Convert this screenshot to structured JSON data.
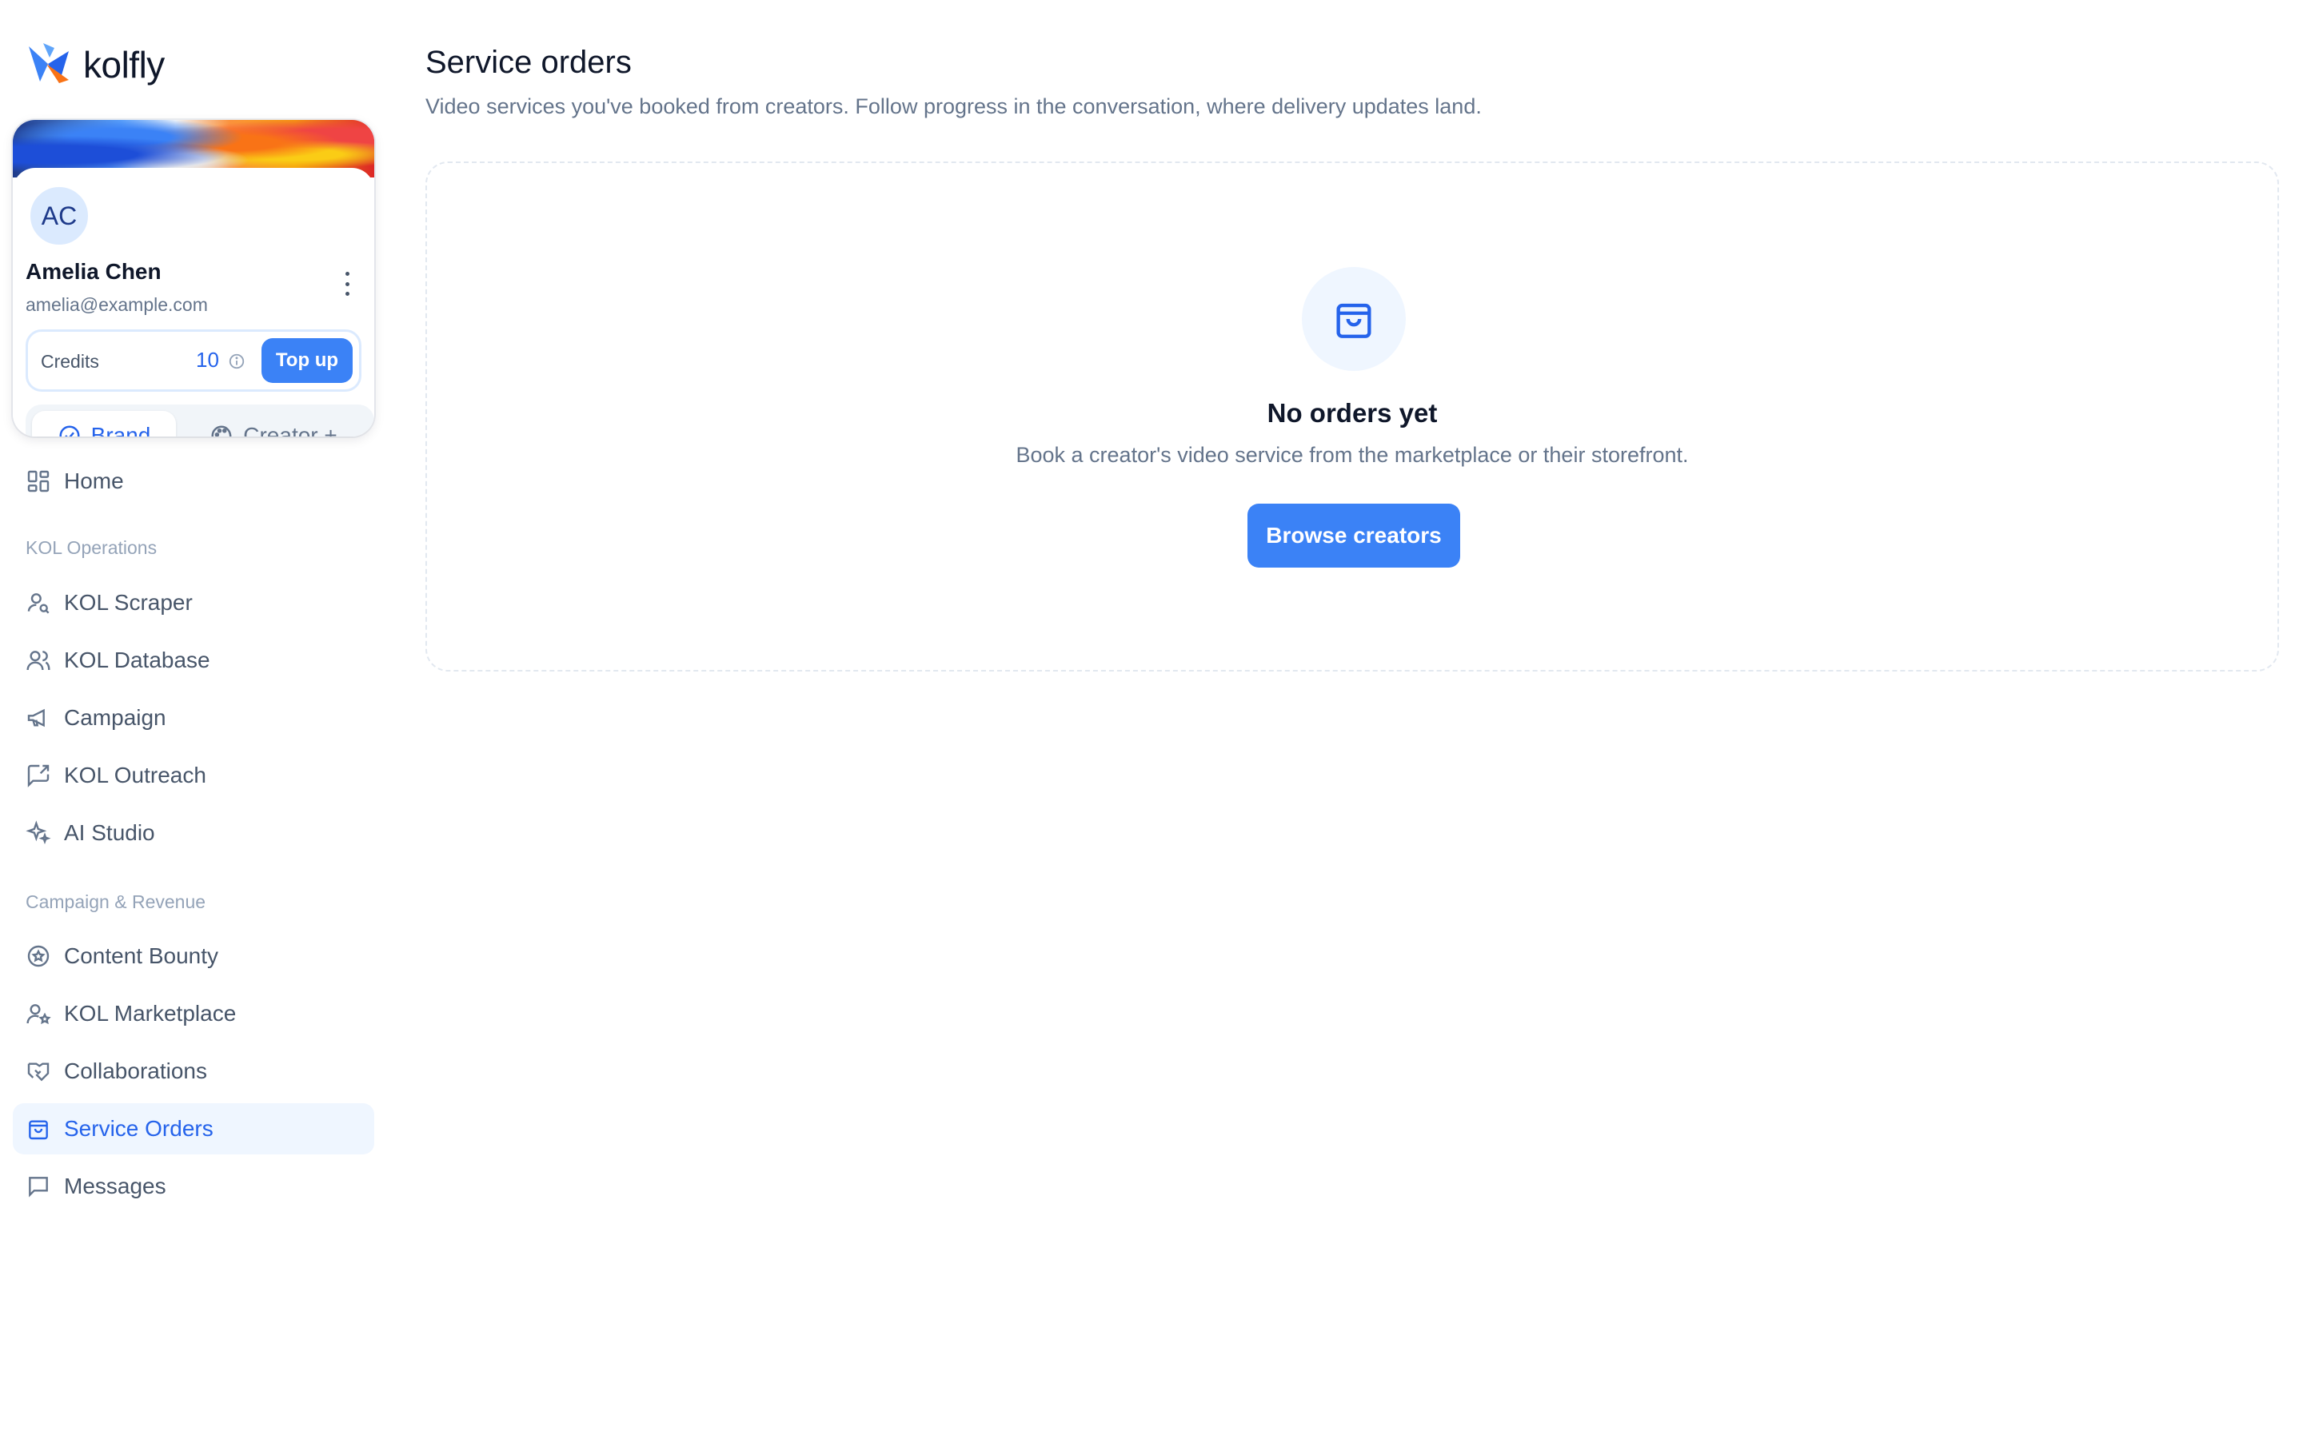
{
  "app": {
    "name": "kolfly"
  },
  "profile": {
    "initials": "AC",
    "name": "Amelia Chen",
    "email": "amelia@example.com",
    "credits_label": "Credits",
    "credits_value": "10",
    "topup_label": "Top up"
  },
  "role_switch": {
    "brand_label": "Brand",
    "creator_label": "Creator +",
    "selected": "Brand"
  },
  "nav": {
    "home": "Home",
    "section_ops": "KOL Operations",
    "kol_scraper": "KOL Scraper",
    "kol_database": "KOL Database",
    "campaign": "Campaign",
    "kol_outreach": "KOL Outreach",
    "ai_studio": "AI Studio",
    "section_revenue": "Campaign & Revenue",
    "content_bounty": "Content Bounty",
    "kol_marketplace": "KOL Marketplace",
    "collaborations": "Collaborations",
    "service_orders": "Service Orders",
    "messages": "Messages",
    "active": "Service Orders"
  },
  "main": {
    "title": "Service orders",
    "subtitle": "Video services you've booked from creators. Follow progress in the conversation, where delivery updates land.",
    "empty_title": "No orders yet",
    "empty_desc": "Book a creator's video service from the marketplace or their storefront.",
    "browse_label": "Browse creators"
  },
  "colors": {
    "accent": "#3b82f6",
    "accent_text": "#2563eb",
    "active_bg": "#eff6ff"
  }
}
